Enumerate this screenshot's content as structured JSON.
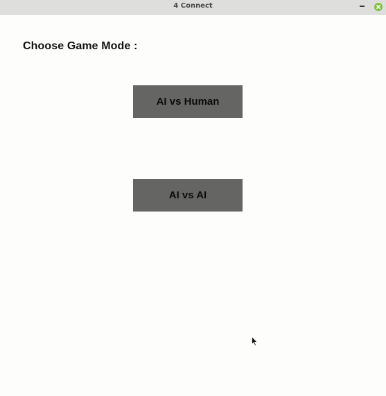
{
  "window": {
    "title": "4 Connect",
    "controls": {
      "minimize_icon": "minimize-icon",
      "close_icon": "close-icon",
      "close_color": "#86be43"
    }
  },
  "main": {
    "heading": "Choose Game Mode :",
    "buttons": [
      {
        "label": "AI vs Human",
        "color": "#656564"
      },
      {
        "label": "AI vs AI",
        "color": "#656564"
      }
    ]
  }
}
